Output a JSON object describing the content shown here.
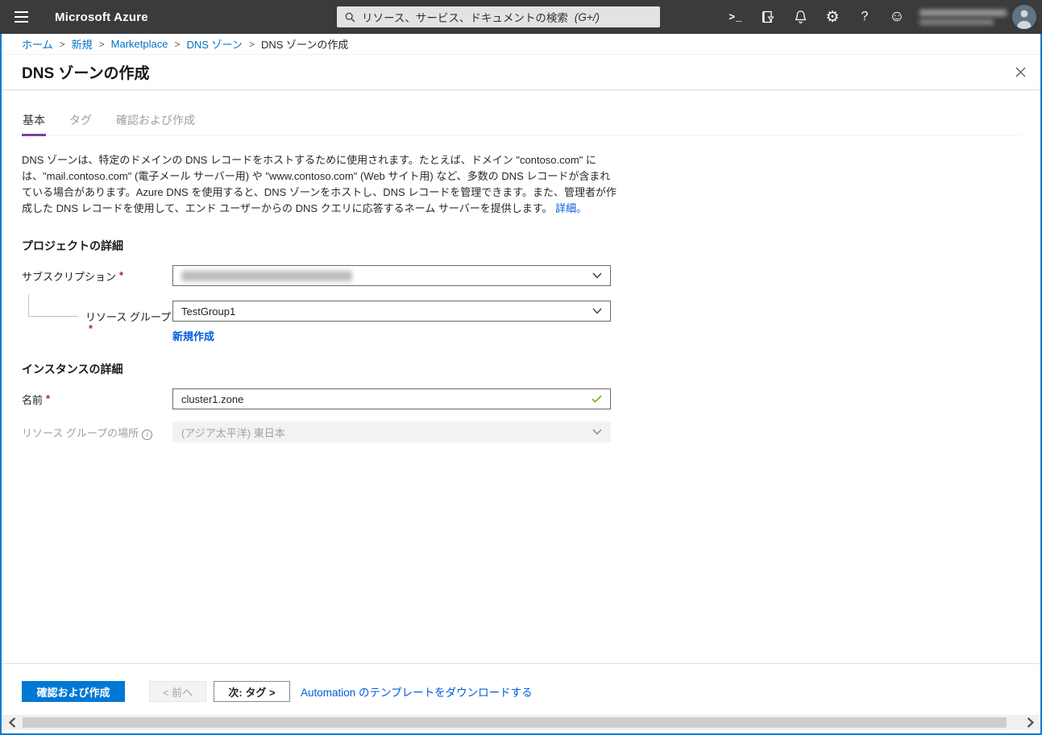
{
  "colors": {
    "topbar_bg": "#3b3b3b",
    "accent_blue": "#0078d4",
    "link_blue": "#015cda",
    "breadcrumb_link_blue": "#0072c9",
    "tab_active_underline": "#7c3fa5",
    "required_red": "#9f2b2b",
    "valid_green": "#5db300",
    "window_focus_border": "#0f7bd3"
  },
  "ui": {
    "required_marker": "*",
    "info_glyph": "i",
    "cloud_shell_glyph": ">_",
    "help_glyph": "?",
    "settings_glyph": "⚙",
    "feedback_glyph": "☺"
  },
  "topbar": {
    "brand": "Microsoft Azure",
    "search": {
      "placeholder": "リソース、サービス、ドキュメントの検索",
      "shortcut_hint": "(G+/)"
    },
    "icons": [
      "cloud-shell",
      "directory-filter",
      "notifications",
      "settings",
      "help",
      "feedback"
    ],
    "account_redacted": true
  },
  "breadcrumb": {
    "separator": ">",
    "items": [
      {
        "label": "ホーム",
        "link": true
      },
      {
        "label": "新規",
        "link": true
      },
      {
        "label": "Marketplace",
        "link": true
      },
      {
        "label": "DNS ゾーン",
        "link": true
      },
      {
        "label": "DNS ゾーンの作成",
        "link": false
      }
    ]
  },
  "page": {
    "title": "DNS ゾーンの作成"
  },
  "tabs": [
    {
      "label": "基本",
      "active": true
    },
    {
      "label": "タグ",
      "active": false
    },
    {
      "label": "確認および作成",
      "active": false
    }
  ],
  "intro": {
    "text": "DNS ゾーンは、特定のドメインの DNS レコードをホストするために使用されます。たとえば、ドメイン \"contoso.com\" には、\"mail.contoso.com\" (電子メール サーバー用) や \"www.contoso.com\" (Web サイト用) など、多数の DNS レコードが含まれている場合があります。Azure DNS を使用すると、DNS ゾーンをホストし、DNS レコードを管理できます。また、管理者が作成した DNS レコードを使用して、エンド ユーザーからの DNS クエリに応答するネーム サーバーを提供します。",
    "learn_more": "詳細。"
  },
  "form": {
    "sections": {
      "project": "プロジェクトの詳細",
      "instance": "インスタンスの詳細"
    },
    "subscription": {
      "label": "サブスクリプション",
      "required": true,
      "value_redacted": true
    },
    "resource_group": {
      "label": "リソース グループ",
      "required": true,
      "value": "TestGroup1",
      "create_new_label": "新規作成"
    },
    "name": {
      "label": "名前",
      "required": true,
      "value": "cluster1.zone",
      "valid": true
    },
    "location": {
      "label": "リソース グループの場所",
      "value": "(アジア太平洋) 東日本",
      "disabled": true
    }
  },
  "footer": {
    "review_create_label": "確認および作成",
    "previous_label": "< 前へ",
    "next_label": "次: タグ >",
    "automation_link": "Automation のテンプレートをダウンロードする"
  }
}
